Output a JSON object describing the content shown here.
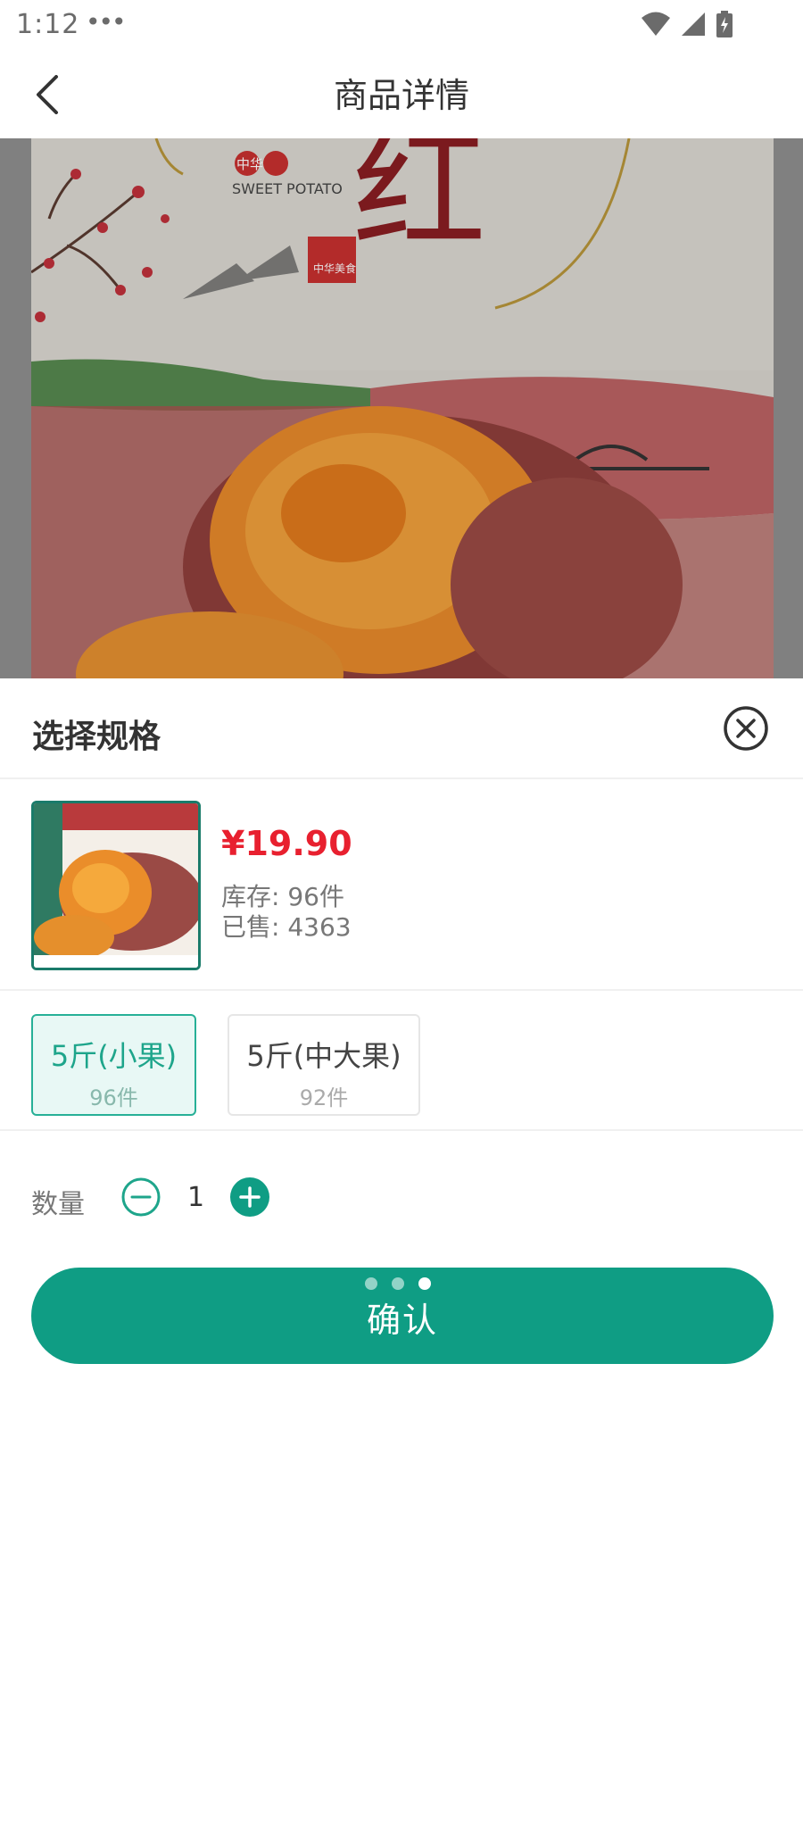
{
  "status_bar": {
    "time": "1:12",
    "dots": "•••"
  },
  "header": {
    "title": "商品详情",
    "back_icon": "chevron-left-icon"
  },
  "hero": {
    "brand_text": "中华",
    "brand_subtitle": "SWEET POTATO",
    "seal_text": "中华美食",
    "big_char": "红",
    "pager_count": 3,
    "pager_active_index": 2
  },
  "sheet": {
    "title": "选择规格",
    "close_icon": "close-circle-icon"
  },
  "product": {
    "price": "¥19.90",
    "stock": "库存: 96件",
    "sold": "已售: 4363"
  },
  "specs": [
    {
      "name": "5斤(小果)",
      "stock": "96件",
      "selected": true
    },
    {
      "name": "5斤(中大果)",
      "stock": "92件",
      "selected": false
    }
  ],
  "quantity": {
    "label": "数量",
    "value": "1",
    "minus_icon": "minus-circle-icon",
    "plus_icon": "plus-circle-icon"
  },
  "confirm": {
    "label": "确认"
  },
  "colors": {
    "accent": "#0f9d84",
    "price": "#e8202f",
    "selected_bg": "#e8f8f5"
  }
}
